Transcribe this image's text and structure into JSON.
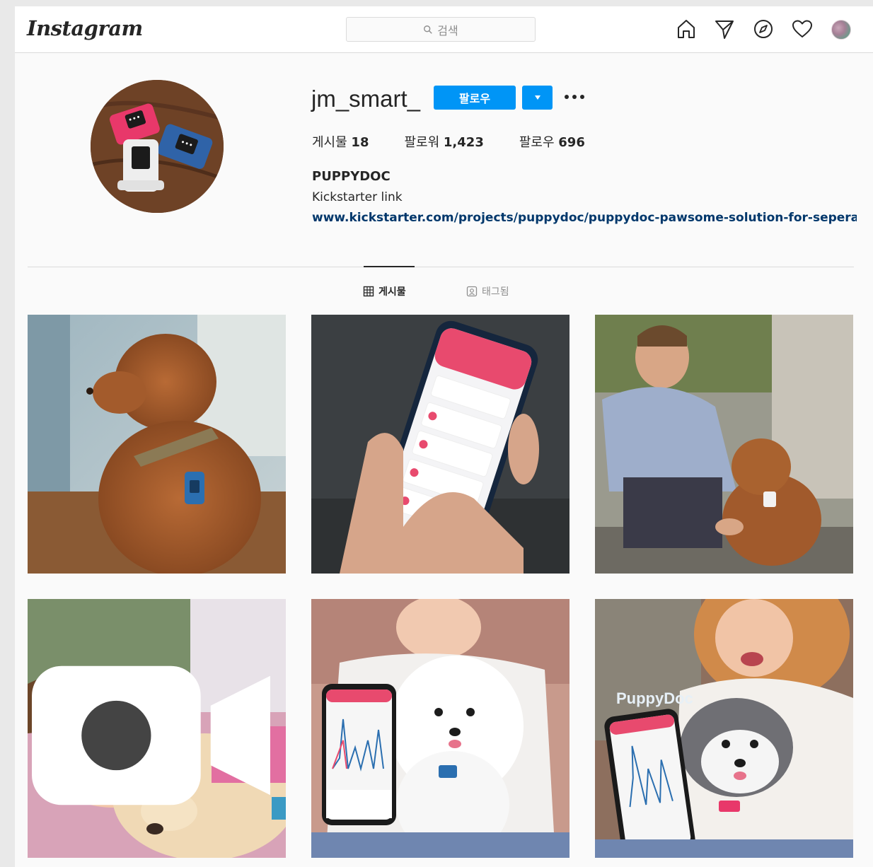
{
  "header": {
    "logo": "Instagram",
    "search_placeholder": "검색",
    "icons": [
      "home-icon",
      "direct-icon",
      "explore-icon",
      "activity-icon",
      "profile-avatar"
    ]
  },
  "profile": {
    "username": "jm_smart_",
    "follow_label": "팔로우",
    "stats": {
      "posts_label": "게시물",
      "posts_count": "18",
      "followers_label": "팔로워",
      "followers_count": "1,423",
      "following_label": "팔로우",
      "following_count": "696"
    },
    "display_name": "PUPPYDOC",
    "bio": "Kickstarter link",
    "link": "www.kickstarter.com/projects/puppydoc/puppydoc-pawsome-solution-for-seperat..."
  },
  "tabs": {
    "posts": "게시물",
    "tagged": "태그됨"
  },
  "posts": [
    {
      "scene": "poodle-with-collar-device"
    },
    {
      "scene": "hand-holding-phone-app"
    },
    {
      "scene": "man-with-poodle"
    },
    {
      "scene": "child-sleeping-with-puppy",
      "video": true
    },
    {
      "scene": "woman-with-bichon-and-phone"
    },
    {
      "scene": "woman-with-dog-and-phone"
    }
  ],
  "colors": {
    "accent": "#0095f6",
    "link": "#00376b",
    "background": "#fafafa",
    "border": "#dbdbdb"
  }
}
